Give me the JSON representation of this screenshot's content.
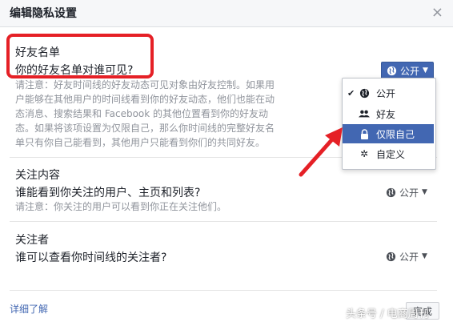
{
  "header": {
    "title": "编辑隐私设置",
    "close_symbol": "×"
  },
  "sections": {
    "friends_list": {
      "title": "好友名单",
      "question": "你的好友名单对谁可见?",
      "audience": "公开",
      "hint_lines": [
        "请注意：好友时间线的好友动态可见对象由好友控制。如果用",
        "户能够在其他用户的时间线看到你的好友动态，他们也能在动",
        "态消息、搜索结果和 Facebook 的其他位置看到你的好友动",
        "态。如果将该项设置为仅限自己，那么你时间线的完整好友名",
        "单只有你自己能看到，其他用户只能看到你们的共同好友。"
      ]
    },
    "following": {
      "title": "关注内容",
      "question": "谁能看到你关注的用户、主页和列表?",
      "hint": "请注意：你关注的用户可以看到你正在关注他们。",
      "audience": "公开"
    },
    "followers": {
      "title": "关注者",
      "question": "谁可以查看你时间线的关注者?",
      "audience": "公开"
    }
  },
  "dropdown": {
    "items": [
      {
        "label": "公开",
        "icon": "globe-icon",
        "checked": true,
        "selected": false
      },
      {
        "label": "好友",
        "icon": "friends-icon",
        "checked": false,
        "selected": false
      },
      {
        "label": "仅限自己",
        "icon": "lock-icon",
        "checked": false,
        "selected": true
      },
      {
        "label": "自定义",
        "icon": "gear-icon",
        "checked": false,
        "selected": false
      }
    ]
  },
  "footer": {
    "learn_more": "详细了解",
    "done": "完成"
  },
  "watermark": "头条号 / 电商周刊",
  "colors": {
    "accent": "#4267b2",
    "annotation_red": "#e52026",
    "hint_gray": "#90949c"
  }
}
